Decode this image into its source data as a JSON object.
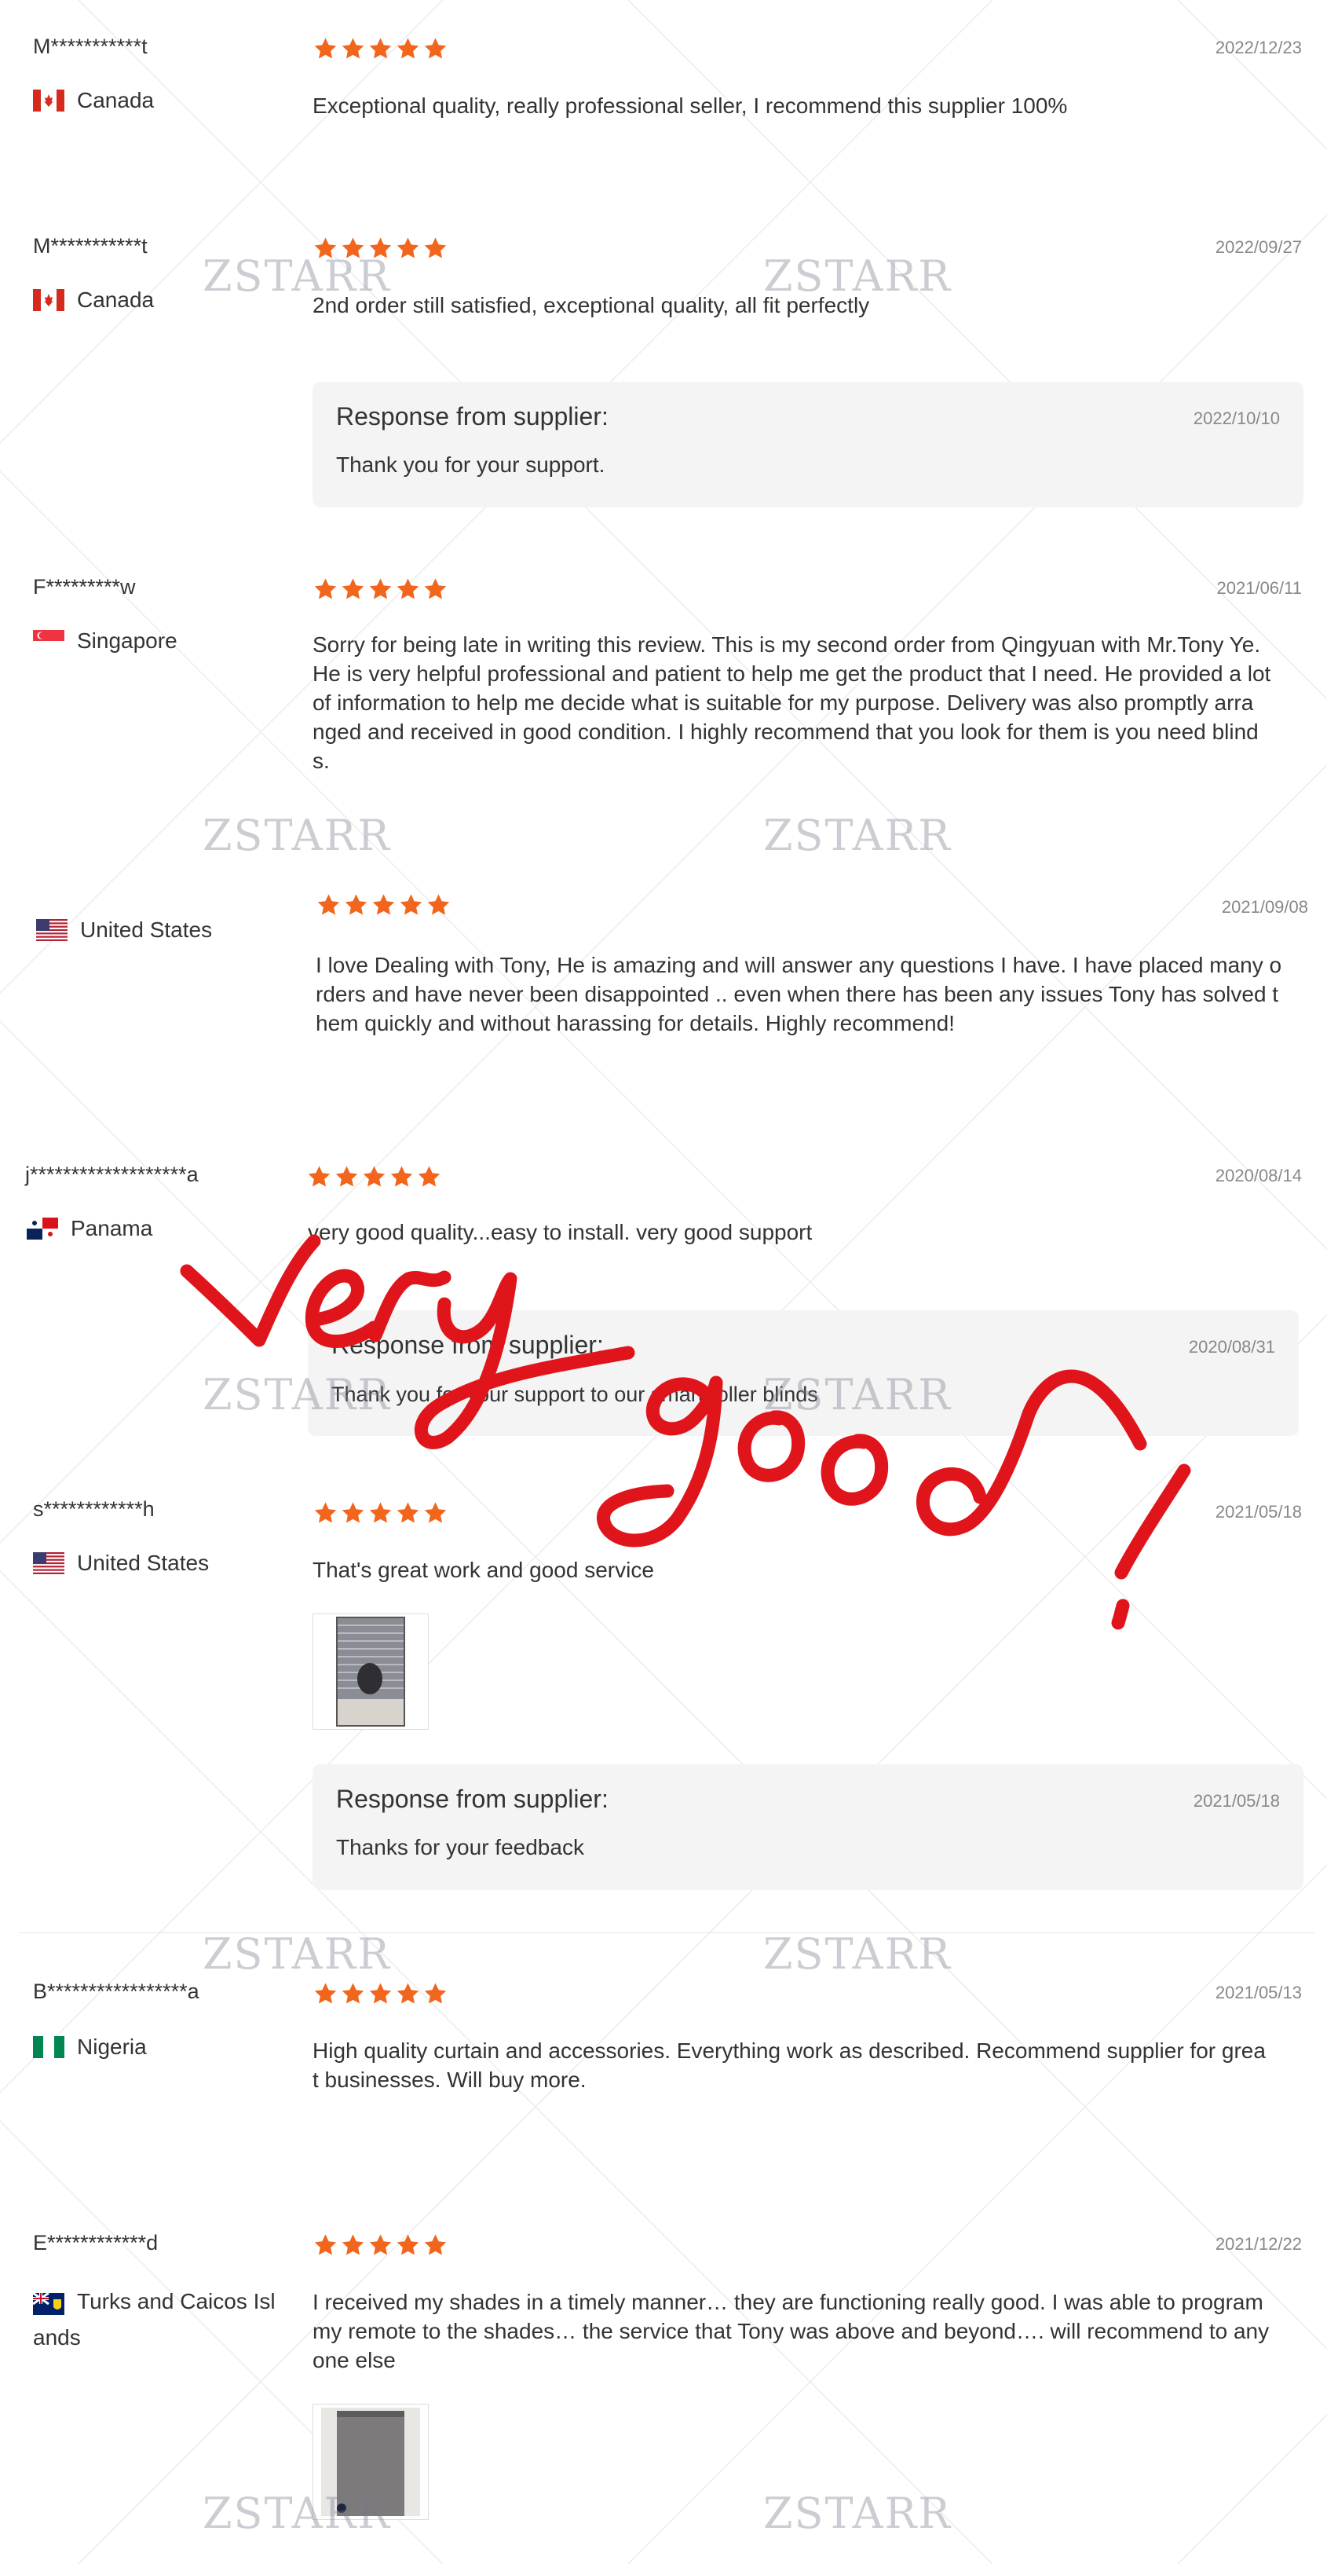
{
  "colors": {
    "star": "#f2651c",
    "text": "#333333",
    "date": "#888888",
    "response_bg": "#f4f4f4",
    "annotation": "#e0151c",
    "watermark": "#78788c"
  },
  "watermark_text": "ZSTARR",
  "annotation_text": "very good!",
  "reviews": [
    {
      "name": "M***********t",
      "country": "Canada",
      "flag": "canada-flag-icon",
      "rating": 5,
      "date": "2022/12/23",
      "text": "Exceptional quality, really professional seller, I recommend this supplier 100%"
    },
    {
      "name": "M***********t",
      "country": "Canada",
      "flag": "canada-flag-icon",
      "rating": 5,
      "date": "2022/09/27",
      "text": "2nd order still satisfied, exceptional quality, all fit perfectly",
      "response": {
        "title": "Response from supplier:",
        "date": "2022/10/10",
        "text": "Thank you for your support."
      }
    },
    {
      "name": "F*********w",
      "country": "Singapore",
      "flag": "singapore-flag-icon",
      "rating": 5,
      "date": "2021/06/11",
      "text_lines": [
        "Sorry for being late in writing this review. This is my second order from Qingyuan with Mr.Tony Ye.",
        "He is very helpful professional and patient to help me get the product that I need. He provided a lot",
        "of information to help me decide what is suitable for my purpose. Delivery was also promptly arra",
        "nged and received in good condition. I highly recommend that you look for them is you need blind",
        "s."
      ]
    },
    {
      "name": "",
      "country": "United States",
      "flag": "us-flag-icon",
      "rating": 5,
      "date": "2021/09/08",
      "text_lines": [
        "I love Dealing with Tony, He is amazing and will answer any questions I have. I have placed many o",
        "rders and have never been disappointed .. even when there has been any issues Tony has solved t",
        "hem quickly and without harassing for details. Highly recommend!"
      ]
    },
    {
      "name": "j*******************a",
      "country": "Panama",
      "flag": "panama-flag-icon",
      "rating": 5,
      "date": "2020/08/14",
      "text": "very good quality...easy to install. very good support",
      "response": {
        "title": "Response from supplier:",
        "date": "2020/08/31",
        "text": "Thank you for your support to our smart roller blinds"
      }
    },
    {
      "name": "s************h",
      "country": "United States",
      "flag": "us-flag-icon",
      "rating": 5,
      "date": "2021/05/18",
      "text": "That's great work and good service",
      "response": {
        "title": "Response from supplier:",
        "date": "2021/05/18",
        "text": "Thanks for your feedback"
      }
    },
    {
      "name": "B*****************a",
      "country": "Nigeria",
      "flag": "nigeria-flag-icon",
      "rating": 5,
      "date": "2021/05/13",
      "text_lines": [
        "High quality curtain and accessories. Everything work as described. Recommend supplier for grea",
        "t businesses. Will buy more."
      ]
    },
    {
      "name": "E************d",
      "country_lines": [
        "Turks and Caicos Isl",
        "ands"
      ],
      "flag": "turks-caicos-flag-icon",
      "rating": 5,
      "date": "2021/12/22",
      "text_lines": [
        "I received my shades in a timely manner… they are functioning really good. I was able to program",
        "my remote to the shades… the service that Tony was above and beyond…. will recommend to any",
        "one else"
      ]
    }
  ]
}
